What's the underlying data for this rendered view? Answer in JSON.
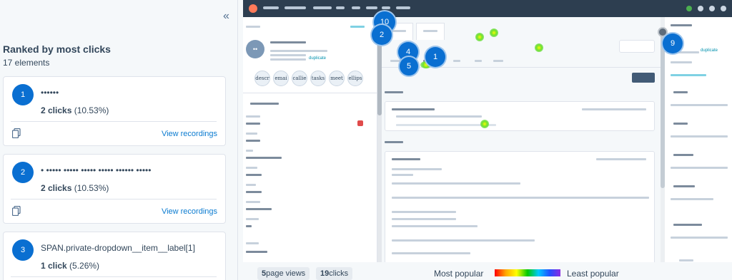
{
  "sidebar": {
    "collapse_glyph": "«",
    "title": "Ranked by most clicks",
    "subtitle": "17 elements",
    "items": [
      {
        "rank": "1",
        "label": "••••••",
        "clicks_bold": "2 clicks",
        "clicks_pct": " (10.53%)",
        "view_label": "View recordings"
      },
      {
        "rank": "2",
        "label": "• ••••• ••••• ••••• ••••• •••••• •••••",
        "clicks_bold": "2 clicks",
        "clicks_pct": " (10.53%)",
        "view_label": "View recordings"
      },
      {
        "rank": "3",
        "label": "SPAN.private-dropdown__item__label[1]",
        "clicks_bold": "1 click",
        "clicks_pct": " (5.26%)"
      }
    ]
  },
  "preview": {
    "avatar_initials": "••",
    "actions": [
      "descr",
      "emai",
      "callie",
      "tasks",
      "meet",
      "ellips"
    ],
    "duplicate_label": "duplicate",
    "markers": [
      "10",
      "2",
      "4",
      "1",
      "5",
      "9"
    ]
  },
  "footer": {
    "page_views_bold": "5",
    "page_views_text": " page views",
    "clicks_bold": "19",
    "clicks_text": " clicks",
    "legend_left": "Most popular",
    "legend_right": "Least popular"
  },
  "colors": {
    "accent": "#0a6fd1",
    "nav_bg": "#2d3e50",
    "link": "#0b7bd0"
  },
  "icons": [
    "collapse-icon",
    "copy-icon",
    "hubspot-logo-icon"
  ]
}
